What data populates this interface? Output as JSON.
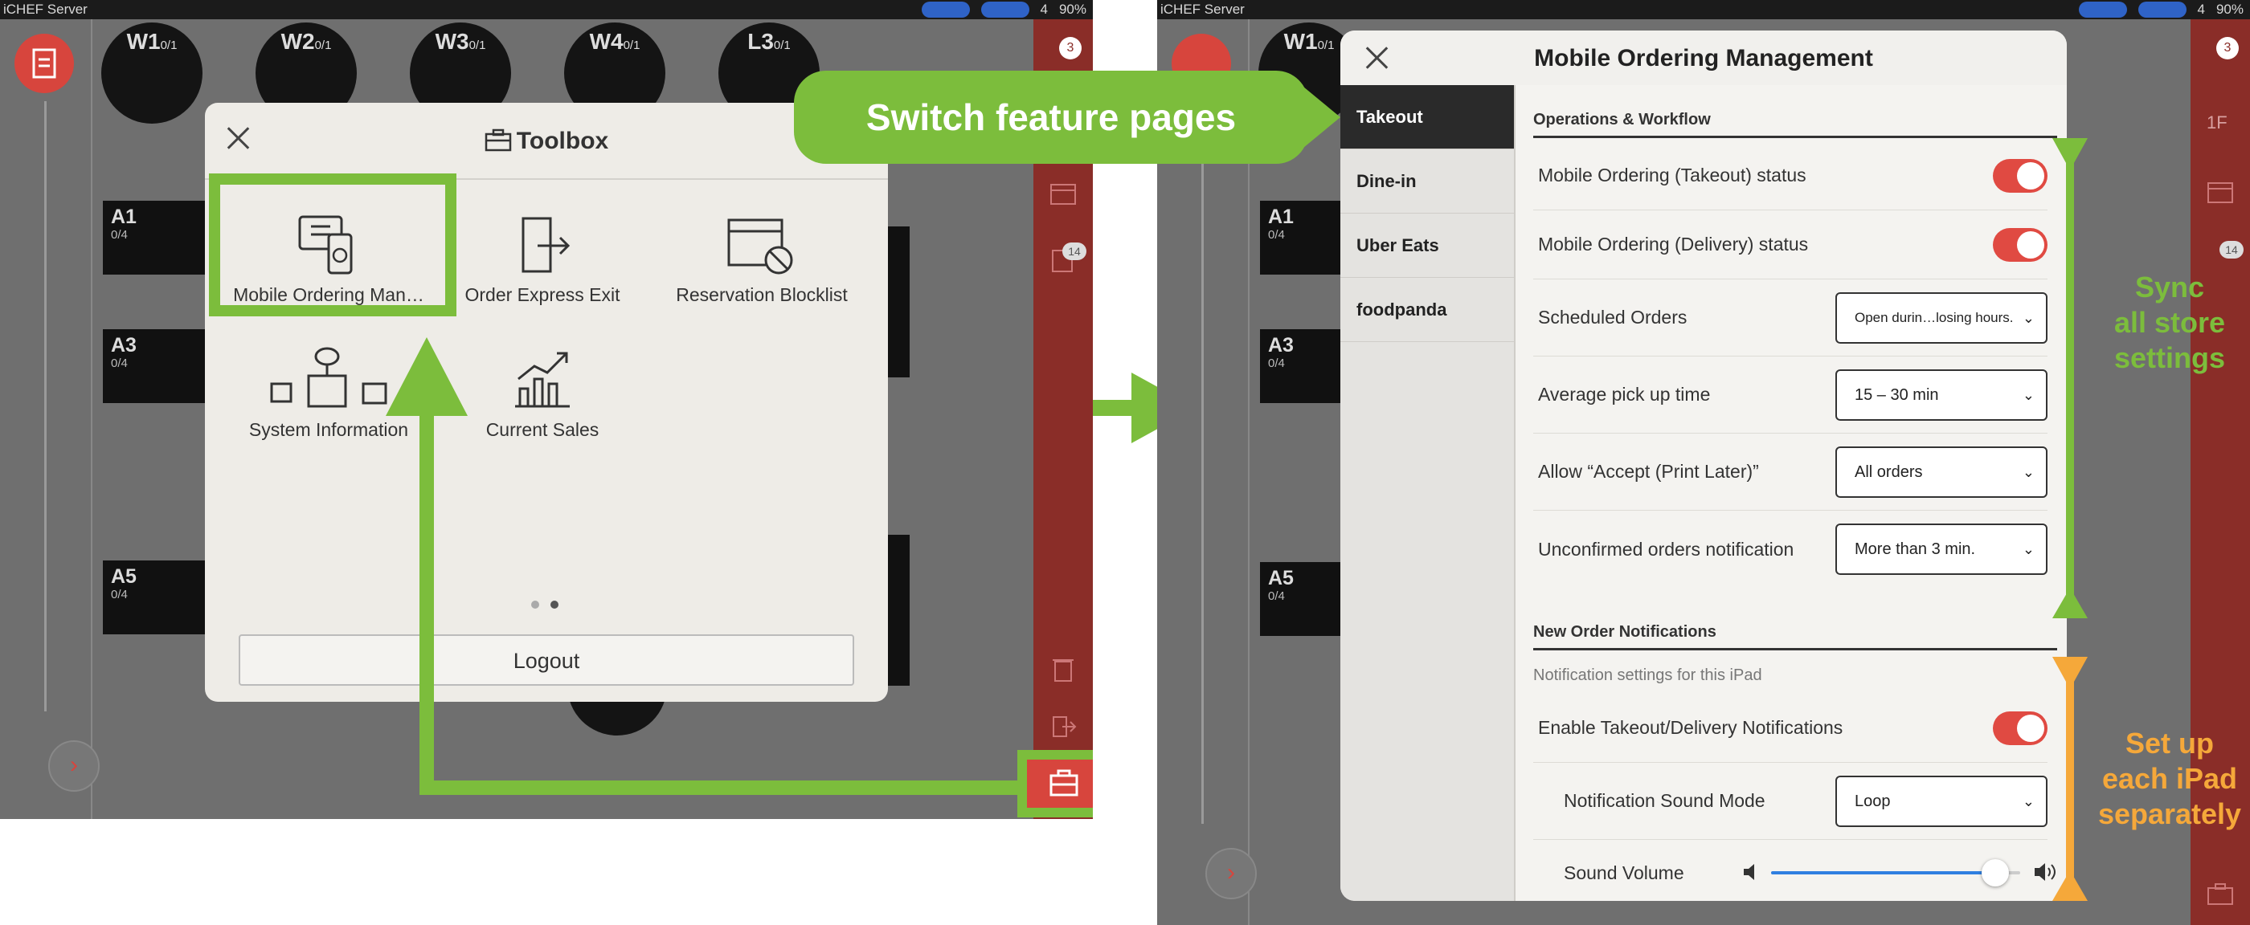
{
  "status_bar": {
    "app_name": "iCHEF Server",
    "people_count": "4",
    "battery": "90%"
  },
  "left_screen": {
    "round_tables": [
      {
        "name": "W1",
        "count": "0/1"
      },
      {
        "name": "W2",
        "count": "0/1"
      },
      {
        "name": "W3",
        "count": "0/1"
      },
      {
        "name": "W4",
        "count": "0/1"
      },
      {
        "name": "L3",
        "count": "0/1"
      }
    ],
    "rect_tables": [
      {
        "name": "A1",
        "count": "0/4"
      },
      {
        "name": "A3",
        "count": "0/4"
      },
      {
        "name": "A5",
        "count": "0/4"
      }
    ],
    "badges": {
      "top": "3",
      "receipts": "14"
    }
  },
  "toolbox": {
    "title": "Toolbox",
    "tools": [
      {
        "label": "Mobile Ordering Man…"
      },
      {
        "label": "Order Express Exit"
      },
      {
        "label": "Reservation Blocklist"
      },
      {
        "label": "System Information"
      },
      {
        "label": "Current Sales"
      }
    ],
    "logout_label": "Logout"
  },
  "callout": {
    "text": "Switch feature pages"
  },
  "right_screen": {
    "floor_label": "1F",
    "badges": {
      "top": "3",
      "receipts": "14"
    },
    "round_tables": [
      {
        "name": "W1",
        "count": "0/1"
      }
    ],
    "rect_tables": [
      {
        "name": "A1",
        "count": "0/4"
      },
      {
        "name": "A3",
        "count": "0/4"
      },
      {
        "name": "A5",
        "count": "0/4"
      }
    ]
  },
  "mobile_ordering": {
    "title": "Mobile Ordering Management",
    "nav": [
      "Takeout",
      "Dine-in",
      "Uber Eats",
      "foodpanda"
    ],
    "section1": "Operations & Workflow",
    "rows1": [
      {
        "label": "Mobile Ordering (Takeout) status"
      },
      {
        "label": "Mobile Ordering (Delivery) status"
      },
      {
        "label": "Scheduled Orders",
        "value": "Open durin…losing hours."
      },
      {
        "label": "Average pick up time",
        "value": "15 – 30 min"
      },
      {
        "label": "Allow “Accept (Print Later)”",
        "value": "All orders"
      },
      {
        "label": "Unconfirmed orders notification",
        "value": "More than 3 min."
      }
    ],
    "section2": "New Order Notifications",
    "section2_sub": "Notification settings for this iPad",
    "rows2": [
      {
        "label": "Enable Takeout/Delivery Notifications"
      },
      {
        "label": "Notification Sound Mode",
        "value": "Loop"
      },
      {
        "label": "Sound Volume"
      }
    ],
    "volume": 0.9
  },
  "annotations": {
    "sync": "Sync\nall store\nsettings",
    "ipad": "Set up\neach iPad\nseparately"
  },
  "colors": {
    "green": "#7cbd3c",
    "orange": "#f5a83a",
    "toggle_red": "#e04a42",
    "slider_blue": "#2f7fe0"
  }
}
